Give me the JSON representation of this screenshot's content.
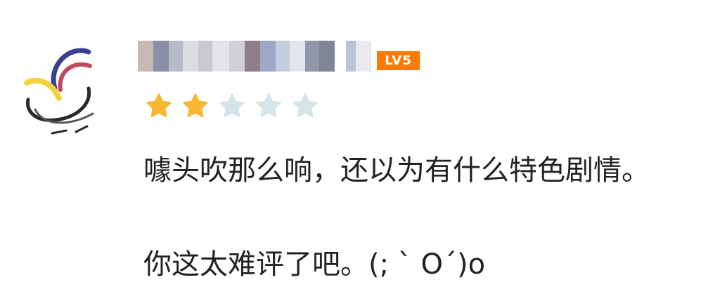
{
  "review": {
    "level_badge": "LV5",
    "rating": {
      "value": 2,
      "max": 5
    },
    "comment_lines": [
      "噱头吹那么响，还以为有什么特色剧情。",
      "你这太难评了吧。(; ` O´)o"
    ]
  },
  "colors": {
    "badge": "#ff7a00",
    "star_filled": "#f7b733",
    "star_empty": "#d6e4ea",
    "text": "#222222"
  },
  "icons": {
    "avatar": "abstract-swirl-avatar",
    "rating_star": "star-icon"
  }
}
